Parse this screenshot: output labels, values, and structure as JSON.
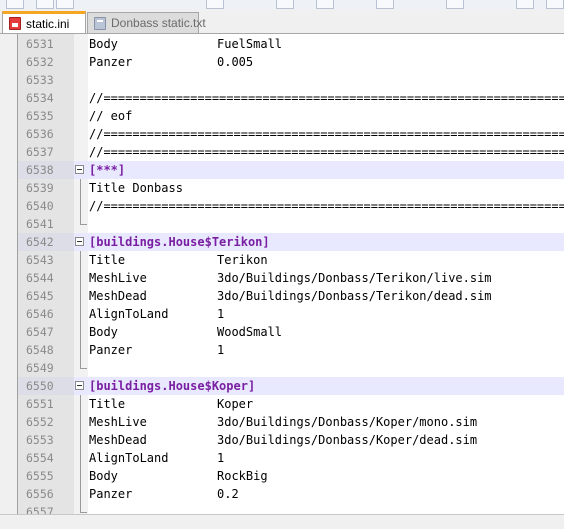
{
  "tabs": [
    {
      "label": "static.ini",
      "active": true
    },
    {
      "label": "Donbass static.txt",
      "active": false
    }
  ],
  "editor": {
    "lines": [
      {
        "num": "6531",
        "key": "Body",
        "value": "FuelSmall"
      },
      {
        "num": "6532",
        "key": "Panzer",
        "value": "0.005"
      },
      {
        "num": "6533",
        "text": ""
      },
      {
        "num": "6534",
        "text": "//================================================================"
      },
      {
        "num": "6535",
        "text": "// eof"
      },
      {
        "num": "6536",
        "text": "//================================================================"
      },
      {
        "num": "6537",
        "text": "//================================================================"
      },
      {
        "num": "6538",
        "text": "[***]",
        "section": true
      },
      {
        "num": "6539",
        "text": "Title Donbass"
      },
      {
        "num": "6540",
        "text": "//================================================================"
      },
      {
        "num": "6541",
        "text": ""
      },
      {
        "num": "6542",
        "text": "[buildings.House$Terikon]",
        "section": true
      },
      {
        "num": "6543",
        "key": "Title",
        "value": "Terikon"
      },
      {
        "num": "6544",
        "key": "MeshLive",
        "value": "3do/Buildings/Donbass/Terikon/live.sim"
      },
      {
        "num": "6545",
        "key": "MeshDead",
        "value": "3do/Buildings/Donbass/Terikon/dead.sim"
      },
      {
        "num": "6546",
        "key": "AlignToLand",
        "value": "1"
      },
      {
        "num": "6547",
        "key": "Body",
        "value": "WoodSmall"
      },
      {
        "num": "6548",
        "key": "Panzer",
        "value": "1"
      },
      {
        "num": "6549",
        "text": ""
      },
      {
        "num": "6550",
        "text": "[buildings.House$Koper]",
        "section": true
      },
      {
        "num": "6551",
        "key": "Title",
        "value": "Koper"
      },
      {
        "num": "6552",
        "key": "MeshLive",
        "value": "3do/Buildings/Donbass/Koper/mono.sim"
      },
      {
        "num": "6553",
        "key": "MeshDead",
        "value": "3do/Buildings/Donbass/Koper/dead.sim"
      },
      {
        "num": "6554",
        "key": "AlignToLand",
        "value": "1"
      },
      {
        "num": "6555",
        "key": "Body",
        "value": "RockBig"
      },
      {
        "num": "6556",
        "key": "Panzer",
        "value": "0.2"
      },
      {
        "num": "6557",
        "text": ""
      }
    ]
  },
  "colors": {
    "section_text": "#7a1fa2",
    "section_highlight": "#e8e8ff",
    "active_tab_accent": "#f5a623"
  }
}
